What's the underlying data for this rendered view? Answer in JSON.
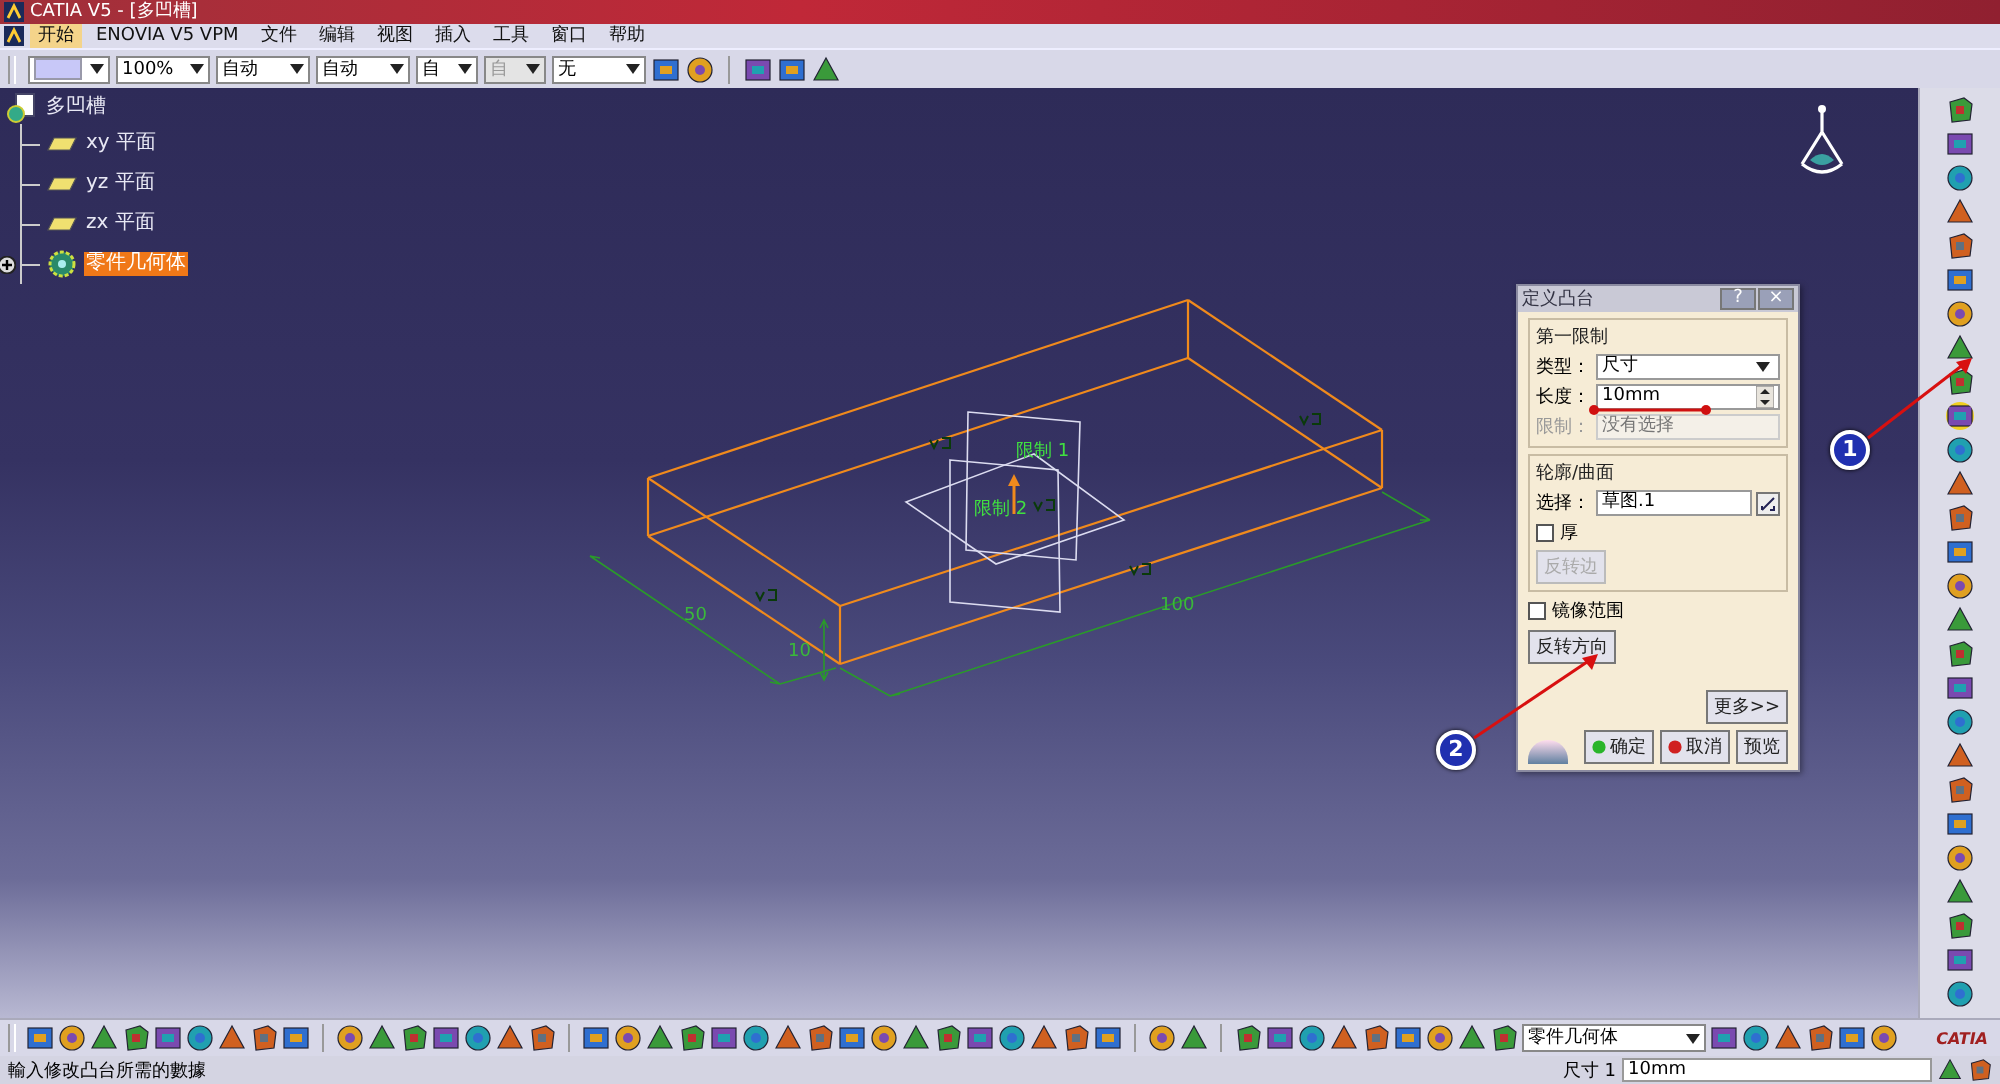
{
  "window": {
    "title": "CATIA V5 - [多凹槽]"
  },
  "menu": [
    {
      "label": "开始",
      "selected": true
    },
    {
      "label": "ENOVIA V5 VPM",
      "selected": false
    },
    {
      "label": "文件",
      "selected": false
    },
    {
      "label": "编辑",
      "selected": false
    },
    {
      "label": "视图",
      "selected": false
    },
    {
      "label": "插入",
      "selected": false
    },
    {
      "label": "工具",
      "selected": false
    },
    {
      "label": "窗口",
      "selected": false
    },
    {
      "label": "帮助",
      "selected": false
    }
  ],
  "format_toolbar": [
    {
      "kind": "swatch"
    },
    {
      "kind": "combo",
      "value": "100%",
      "disabled": false
    },
    {
      "kind": "combo",
      "value": "自动",
      "disabled": false
    },
    {
      "kind": "combo",
      "value": "自动",
      "disabled": false
    },
    {
      "kind": "combo",
      "value": "自",
      "disabled": false
    },
    {
      "kind": "combo",
      "value": "自",
      "disabled": true
    },
    {
      "kind": "combo",
      "value": "无",
      "disabled": false
    }
  ],
  "tree": {
    "label": "多凹槽",
    "children": [
      {
        "kind": "plane",
        "label": "xy 平面",
        "selected": false
      },
      {
        "kind": "plane",
        "label": "yz 平面",
        "selected": false
      },
      {
        "kind": "plane",
        "label": "zx 平面",
        "selected": false
      },
      {
        "kind": "body",
        "label": "零件几何体",
        "selected": true,
        "expanded": false
      }
    ]
  },
  "viewport": {
    "annotations": [
      {
        "kind": "limit",
        "text": "限制 1"
      },
      {
        "kind": "limit",
        "text": "限制 2"
      },
      {
        "kind": "dimension",
        "text": "50"
      },
      {
        "kind": "dimension",
        "text": "100"
      },
      {
        "kind": "dimension",
        "text": "10"
      }
    ]
  },
  "dialog": {
    "title": "定义凸台",
    "help": "?",
    "close": "×",
    "first_limit": {
      "title": "第一限制",
      "type": {
        "label": "类型：",
        "value": "尺寸"
      },
      "length": {
        "label": "长度：",
        "value": "10mm"
      },
      "limit": {
        "label": "限制：",
        "value": "没有选择",
        "disabled": true
      }
    },
    "profile": {
      "title": "轮廓/曲面",
      "select": {
        "label": "选择：",
        "value": "草图.1"
      },
      "thick": {
        "label": "厚",
        "checked": false
      },
      "reverse_side": {
        "label": "反转边",
        "disabled": true
      }
    },
    "mirror": {
      "label": "镜像范围",
      "checked": false
    },
    "reverse_direction": "反转方向",
    "more": "更多>>",
    "buttons": [
      {
        "kind": "ok",
        "label": "确定"
      },
      {
        "kind": "cancel",
        "label": "取消"
      },
      {
        "kind": "preview",
        "label": "预览"
      }
    ]
  },
  "callouts": [
    {
      "label": "1"
    },
    {
      "label": "2"
    }
  ],
  "bottom_toolbar": {
    "part_combo": "零件几何体",
    "logo": "CATIA"
  },
  "status_bar": {
    "message": "輸入修改凸台所需的數據",
    "dimension_label": "尺寸 1",
    "dimension_value": "10mm"
  }
}
